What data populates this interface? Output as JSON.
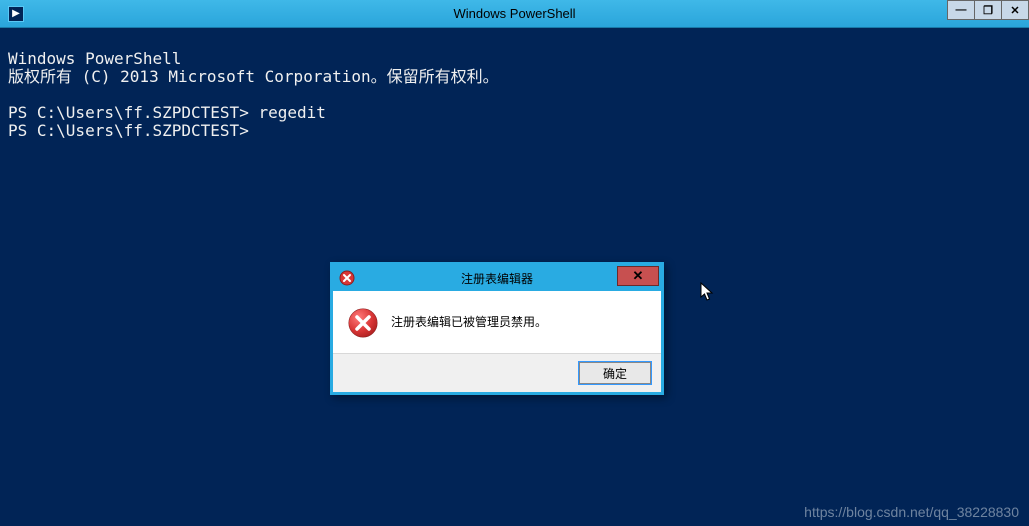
{
  "window": {
    "title": "Windows PowerShell",
    "icon_glyph": "▶",
    "controls": {
      "minimize": "—",
      "maximize": "❐",
      "close": "✕"
    }
  },
  "terminal": {
    "lines": [
      "Windows PowerShell",
      "版权所有 (C) 2013 Microsoft Corporation。保留所有权利。",
      "",
      "PS C:\\Users\\ff.SZPDCTEST> regedit",
      "PS C:\\Users\\ff.SZPDCTEST>"
    ]
  },
  "dialog": {
    "title": "注册表编辑器",
    "close_glyph": "✕",
    "message": "注册表编辑已被管理员禁用。",
    "ok_label": "确定"
  },
  "watermark": "https://blog.csdn.net/qq_38228830"
}
